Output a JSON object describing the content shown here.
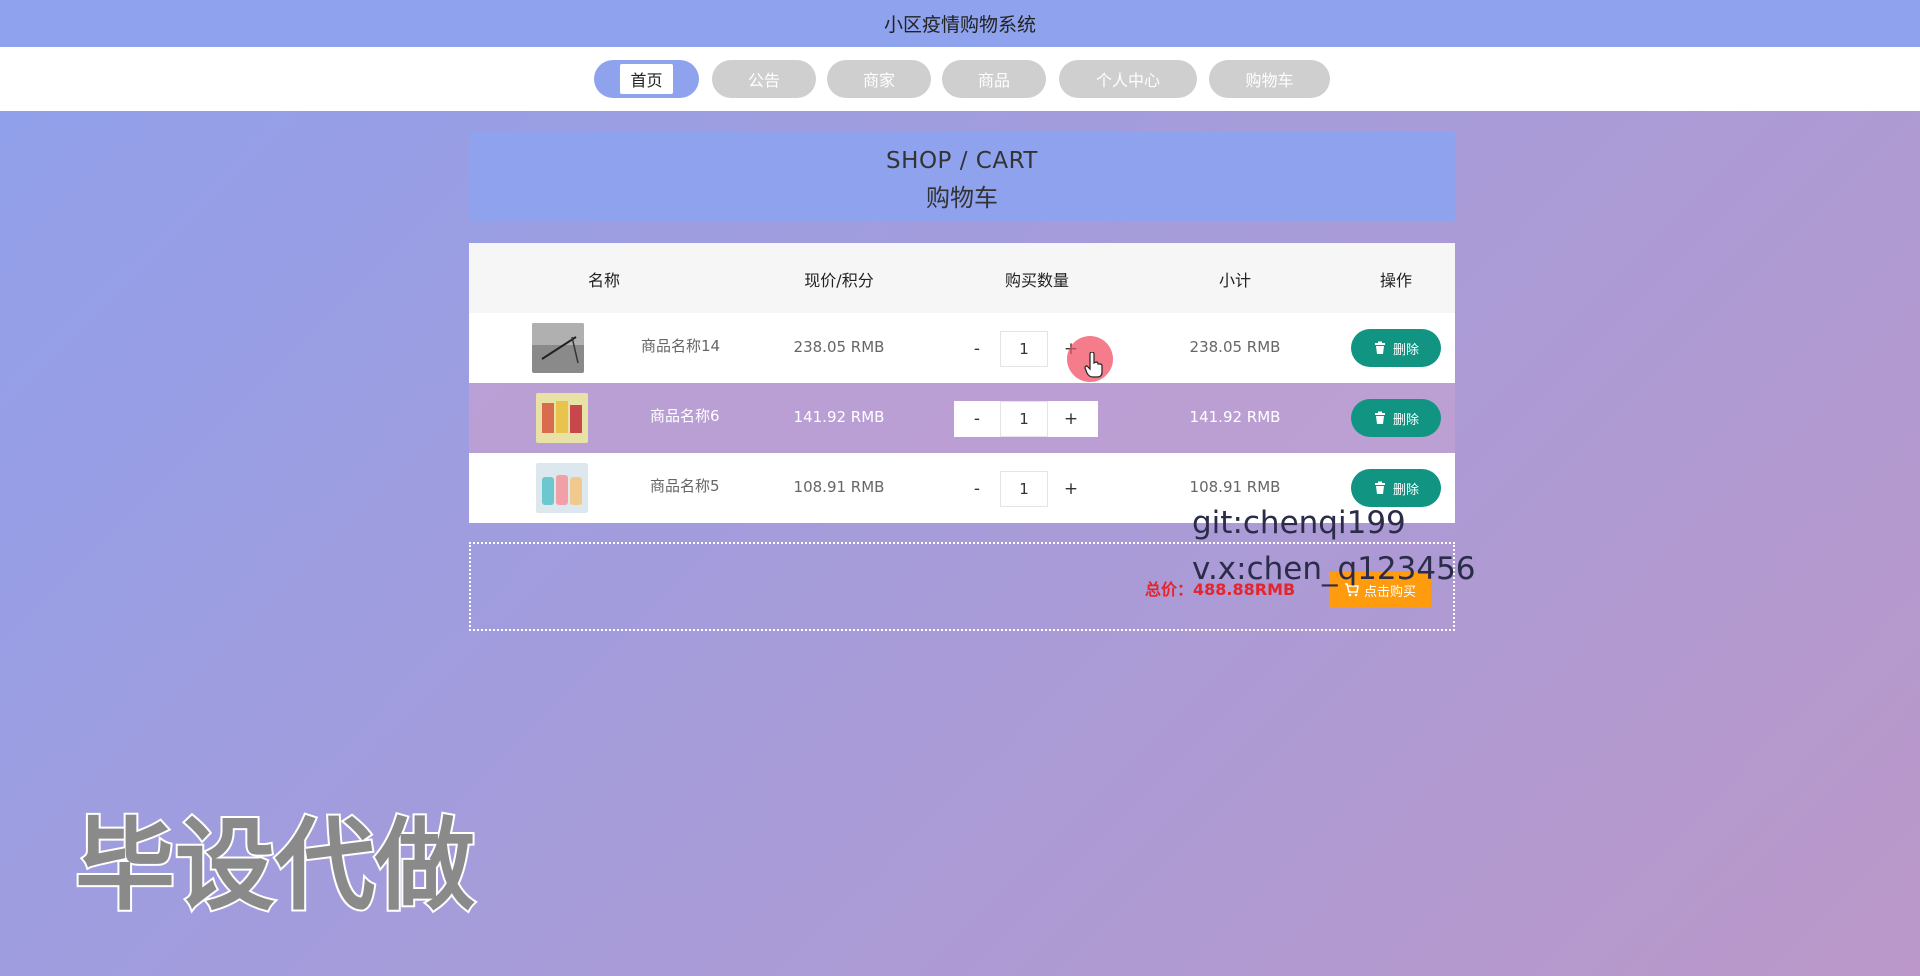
{
  "app": {
    "title": "小区疫情购物系统"
  },
  "nav": {
    "items": [
      {
        "label": "首页",
        "active": true
      },
      {
        "label": "公告",
        "active": false
      },
      {
        "label": "商家",
        "active": false
      },
      {
        "label": "商品",
        "active": false
      },
      {
        "label": "个人中心",
        "active": false
      },
      {
        "label": "购物车",
        "active": false
      }
    ]
  },
  "section": {
    "title_en": "SHOP / CART",
    "title_cn": "购物车"
  },
  "cart": {
    "headers": {
      "name": "名称",
      "price": "现价/积分",
      "qty": "购买数量",
      "subtotal": "小计",
      "action": "操作"
    },
    "items": [
      {
        "name": "商品名称14",
        "price": "238.05 RMB",
        "qty": "1",
        "subtotal": "238.05 RMB",
        "delete_label": "删除",
        "minus": "-",
        "plus": "+"
      },
      {
        "name": "商品名称6",
        "price": "141.92 RMB",
        "qty": "1",
        "subtotal": "141.92 RMB",
        "delete_label": "删除",
        "minus": "-",
        "plus": "+"
      },
      {
        "name": "商品名称5",
        "price": "108.91 RMB",
        "qty": "1",
        "subtotal": "108.91 RMB",
        "delete_label": "删除",
        "minus": "-",
        "plus": "+"
      }
    ]
  },
  "totals": {
    "label": "总价：",
    "value": "488.88RMB",
    "buy_label": "点击购买"
  },
  "overlay": {
    "git": "git:chenqi199",
    "vx": "v.x:chen_q123456",
    "watermark": "毕设代做"
  },
  "colors": {
    "accent": "#8fa2ee",
    "delete": "#119482",
    "buy": "#ff9b0f",
    "price_red": "#e5242b"
  }
}
